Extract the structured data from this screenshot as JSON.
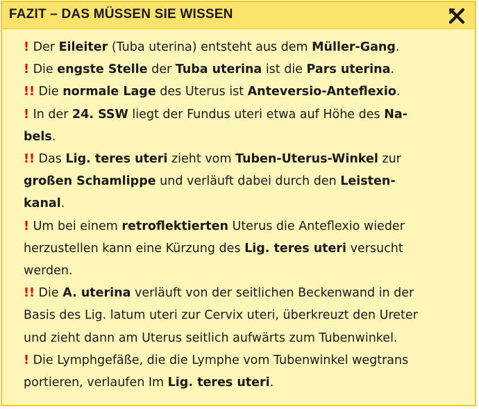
{
  "header": {
    "title": "FAZIT – DAS MÜSSEN SIE WISSEN",
    "close_icon": "close-x-icon"
  },
  "colors": {
    "header_bg": "#fbe36b",
    "box_bg": "#fdf6b8",
    "border": "#f2cc1f",
    "mark": "#e30613"
  },
  "items": [
    {
      "mark": "!",
      "segments": [
        {
          "t": "Der "
        },
        {
          "t": "Eileiter",
          "b": true
        },
        {
          "t": " (Tuba uterina) entsteht aus dem "
        },
        {
          "t": "Müller-Gang",
          "b": true
        },
        {
          "t": "."
        }
      ]
    },
    {
      "mark": "!",
      "segments": [
        {
          "t": "Die "
        },
        {
          "t": "engste Stelle",
          "b": true
        },
        {
          "t": " der "
        },
        {
          "t": "Tuba uterina",
          "b": true
        },
        {
          "t": " ist die "
        },
        {
          "t": "Pars uterina",
          "b": true
        },
        {
          "t": "."
        }
      ]
    },
    {
      "mark": "!!",
      "segments": [
        {
          "t": "Die "
        },
        {
          "t": "normale Lage",
          "b": true
        },
        {
          "t": " des Uterus ist "
        },
        {
          "t": "Anteversio-Anteflexio",
          "b": true
        },
        {
          "t": "."
        }
      ]
    },
    {
      "mark": "!",
      "segments": [
        {
          "t": "In der "
        },
        {
          "t": "24. SSW",
          "b": true
        },
        {
          "t": " liegt der Fundus uteri etwa auf Höhe des "
        },
        {
          "t": "Na-",
          "b": true,
          "br": true
        },
        {
          "t": "bels",
          "b": true
        },
        {
          "t": "."
        }
      ]
    },
    {
      "mark": "!!",
      "segments": [
        {
          "t": "Das "
        },
        {
          "t": "Lig. teres uteri",
          "b": true
        },
        {
          "t": " zieht vom "
        },
        {
          "t": "Tuben-Uterus-Winkel",
          "b": true
        },
        {
          "t": " zur",
          "br": true
        },
        {
          "t": "großen Schamlippe",
          "b": true
        },
        {
          "t": " und verläuft dabei durch den "
        },
        {
          "t": "Leisten-",
          "b": true,
          "br": true
        },
        {
          "t": "kanal",
          "b": true
        },
        {
          "t": "."
        }
      ]
    },
    {
      "mark": "!",
      "segments": [
        {
          "t": "Um bei einem "
        },
        {
          "t": "retroflektierten",
          "b": true
        },
        {
          "t": " Uterus die Anteflexio wieder",
          "br": true
        },
        {
          "t": "herzustellen kann eine Kürzung des "
        },
        {
          "t": "Lig. teres uteri",
          "b": true
        },
        {
          "t": " versucht",
          "br": true
        },
        {
          "t": "werden."
        }
      ]
    },
    {
      "mark": "!!",
      "segments": [
        {
          "t": "Die "
        },
        {
          "t": "A. uterina",
          "b": true
        },
        {
          "t": " verläuft von der seitlichen Beckenwand in der",
          "br": true
        },
        {
          "t": "Basis des Lig. latum uteri zur Cervix uteri, überkreuzt den Ureter",
          "br": true
        },
        {
          "t": "und zieht dann am Uterus seitlich aufwärts zum Tubenwinkel."
        }
      ]
    },
    {
      "mark": "!",
      "segments": [
        {
          "t": "Die Lymphgefäße, die die Lymphe vom Tubenwinkel wegtrans",
          "br": true
        },
        {
          "t": "portieren, verlaufen Im "
        },
        {
          "t": "Lig. teres uteri",
          "b": true
        },
        {
          "t": "."
        }
      ]
    }
  ]
}
